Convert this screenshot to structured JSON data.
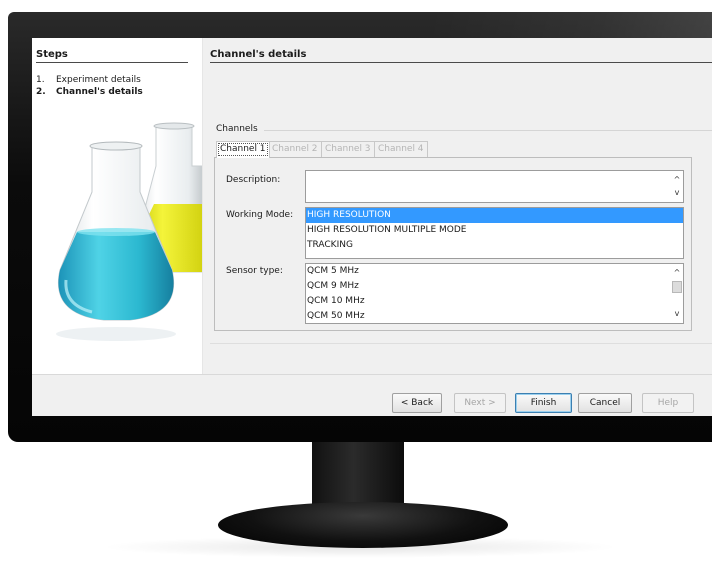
{
  "steps": {
    "title": "Steps",
    "items": [
      {
        "num": "1.",
        "label": "Experiment details"
      },
      {
        "num": "2.",
        "label": "Channel's details"
      }
    ]
  },
  "content": {
    "title": "Channel's details",
    "channels_label": "Channels",
    "tabs": [
      "Channel 1",
      "Channel 2",
      "Channel 3",
      "Channel 4"
    ],
    "description": {
      "label": "Description:",
      "value": ""
    },
    "working_mode": {
      "label": "Working Mode:",
      "options": [
        "HIGH RESOLUTION",
        "HIGH RESOLUTION MULTIPLE MODE",
        "TRACKING"
      ],
      "selected": "HIGH RESOLUTION"
    },
    "sensor_type": {
      "label": "Sensor type:",
      "options": [
        "QCM 5 MHz",
        "QCM 9 MHz",
        "QCM 10 MHz",
        "QCM 50 MHz"
      ]
    }
  },
  "buttons": {
    "back": "< Back",
    "next": "Next >",
    "finish": "Finish",
    "cancel": "Cancel",
    "help": "Help"
  },
  "colors": {
    "selection": "#3399ff",
    "flask_blue": "#2bb8d0",
    "flask_yellow": "#e6e617"
  }
}
